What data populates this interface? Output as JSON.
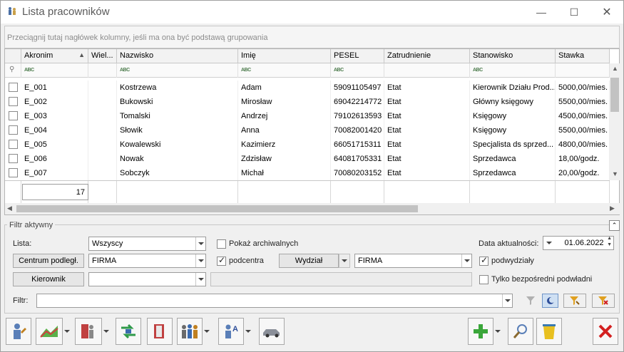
{
  "window": {
    "title": "Lista pracowników",
    "minimize": "—",
    "maximize": "☐",
    "close": "✕"
  },
  "group_hint": "Przeciągnij tutaj nagłówek kolumny, jeśli ma ona być podstawą grupowania",
  "columns": [
    "Akronim",
    "Wiel...",
    "Nazwisko",
    "Imię",
    "PESEL",
    "Zatrudnienie",
    "Stanowisko",
    "Stawka"
  ],
  "filter_icon_text": "ABC",
  "rows": [
    {
      "akronim": "E_001",
      "nazwisko": "Kostrzewa",
      "imie": "Adam",
      "pesel": "59091105497",
      "zatrudnienie": "Etat",
      "stanowisko": "Kierownik Działu Prod...",
      "stawka": "5000,00/mies."
    },
    {
      "akronim": "E_002",
      "nazwisko": "Bukowski",
      "imie": "Mirosław",
      "pesel": "69042214772",
      "zatrudnienie": "Etat",
      "stanowisko": "Główny księgowy",
      "stawka": "5500,00/mies."
    },
    {
      "akronim": "E_003",
      "nazwisko": "Tomalski",
      "imie": "Andrzej",
      "pesel": "79102613593",
      "zatrudnienie": "Etat",
      "stanowisko": "Księgowy",
      "stawka": "4500,00/mies."
    },
    {
      "akronim": "E_004",
      "nazwisko": "Słowik",
      "imie": "Anna",
      "pesel": "70082001420",
      "zatrudnienie": "Etat",
      "stanowisko": "Księgowy",
      "stawka": "5500,00/mies."
    },
    {
      "akronim": "E_005",
      "nazwisko": "Kowalewski",
      "imie": "Kazimierz",
      "pesel": "66051715311",
      "zatrudnienie": "Etat",
      "stanowisko": "Specjalista ds sprzed...",
      "stawka": "4800,00/mies."
    },
    {
      "akronim": "E_006",
      "nazwisko": "Nowak",
      "imie": "Zdzisław",
      "pesel": "64081705331",
      "zatrudnienie": "Etat",
      "stanowisko": "Sprzedawca",
      "stawka": "18,00/godz."
    },
    {
      "akronim": "E_007",
      "nazwisko": "Sobczyk",
      "imie": "Michał",
      "pesel": "70080203152",
      "zatrudnienie": "Etat",
      "stanowisko": "Sprzedawca",
      "stawka": "20,00/godz."
    }
  ],
  "count": "17",
  "filter": {
    "legend": "Filtr aktywny",
    "lista_label": "Lista:",
    "lista_value": "Wszyscy",
    "archiwalni_label": "Pokaż archiwalnych",
    "archiwalni_checked": false,
    "data_label": "Data aktualności:",
    "data_value": "01.06.2022",
    "centrum_btn": "Centrum podległ.",
    "centrum_value": "FIRMA",
    "podcentra_label": "podcentra",
    "podcentra_checked": true,
    "wydzial_btn": "Wydział",
    "wydzial_value": "FIRMA",
    "podwydzialy_label": "podwydziały",
    "podwydzialy_checked": true,
    "kierownik_btn": "Kierownik",
    "kierownik_value": "",
    "bezposredni_label": "Tylko bezpośredni podwładni",
    "bezposredni_checked": false,
    "filtr_label": "Filtr:",
    "filtr_value": ""
  },
  "colors": {
    "accent_green": "#3aa63a",
    "close_red": "#d32020",
    "titlebar": "#ffffff"
  }
}
